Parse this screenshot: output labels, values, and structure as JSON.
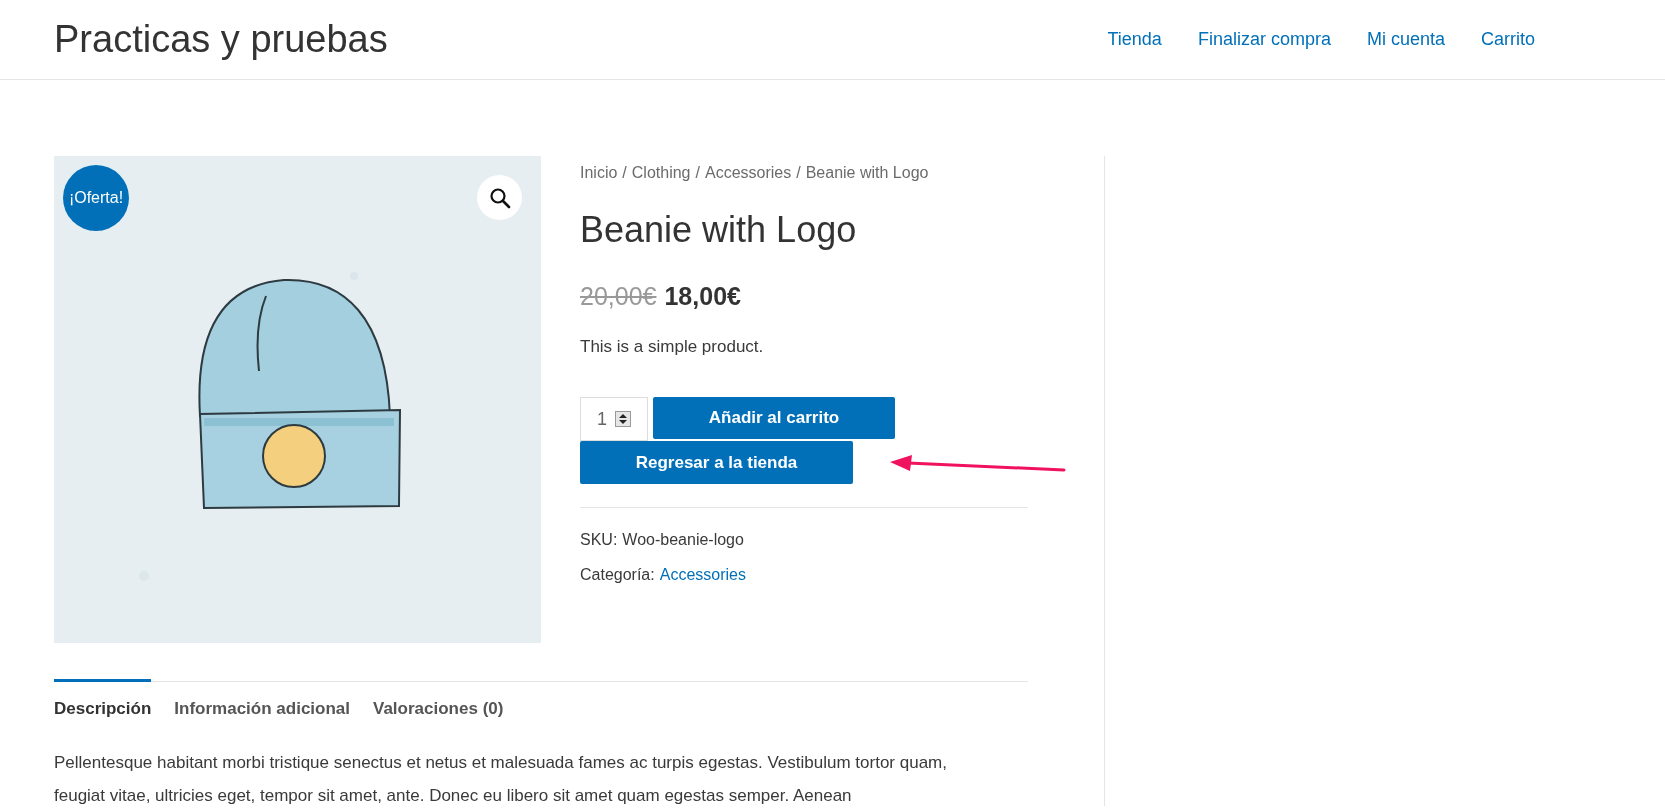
{
  "site_title": "Practicas y pruebas",
  "nav": [
    {
      "label": "Tienda"
    },
    {
      "label": "Finalizar compra"
    },
    {
      "label": "Mi cuenta"
    },
    {
      "label": "Carrito"
    }
  ],
  "product_image": {
    "badge": "¡Oferta!"
  },
  "breadcrumb": [
    "Inicio",
    "Clothing",
    "Accessories",
    "Beanie with Logo"
  ],
  "breadcrumb_separator": "/",
  "title": "Beanie with Logo",
  "old_price": "20,00€",
  "price": "18,00€",
  "short_description": "This is a simple product.",
  "quantity": "1",
  "add_to_cart": "Añadir al carrito",
  "back_to_shop": "Regresar a la tienda",
  "sku": {
    "label": "SKU:",
    "value": "Woo-beanie-logo"
  },
  "category": {
    "label": "Categoría:",
    "value": "Accessories"
  },
  "tabs": [
    {
      "label": "Descripción",
      "selected": true
    },
    {
      "label": "Información adicional",
      "selected": false
    },
    {
      "label": "Valoraciones (0)",
      "selected": false
    }
  ],
  "description": "Pellentesque habitant morbi tristique senectus et netus et malesuada fames ac turpis egestas. Vestibulum tortor quam, feugiat vitae, ultricies eget, tempor sit amet, ante. Donec eu libero sit amet quam egestas semper. Aenean"
}
